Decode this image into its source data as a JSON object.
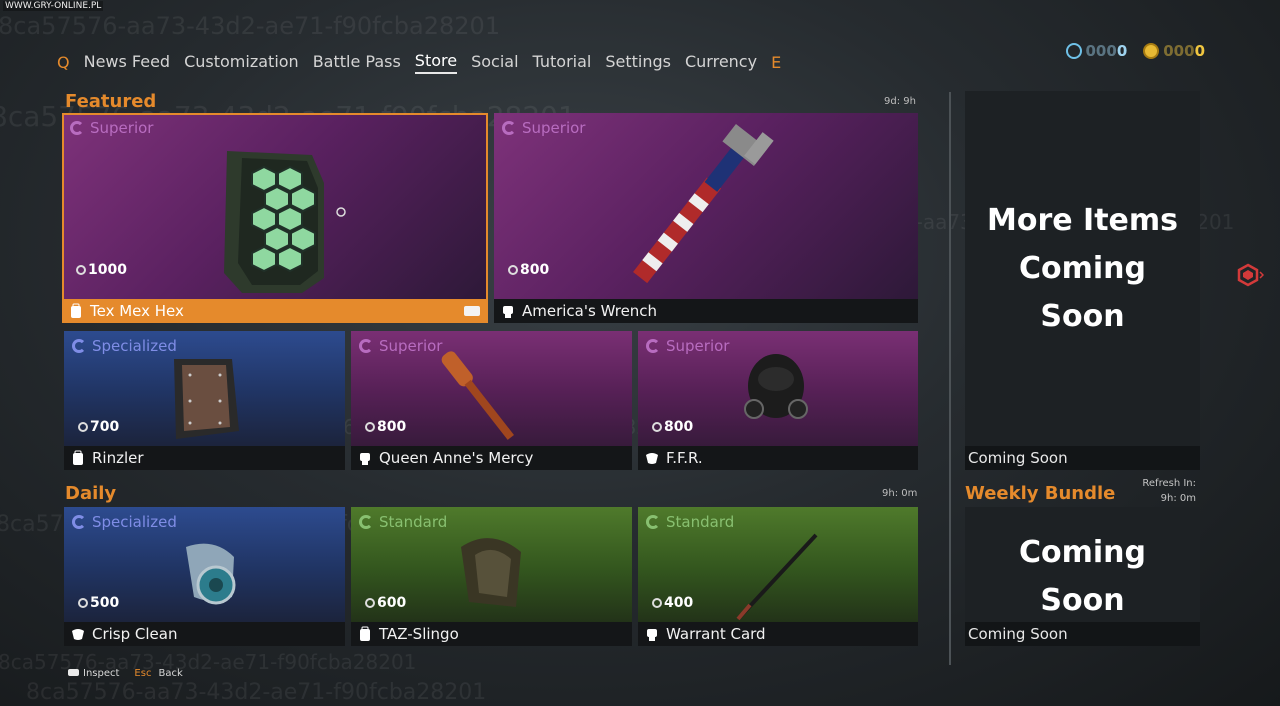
{
  "watermark": "8ca57576-aa73-43d2-ae71-f90fcba28201",
  "site_tag": "WWW.GRY-ONLINE.PL",
  "nav": {
    "left_key": "Q",
    "right_key": "E",
    "tabs": [
      "News Feed",
      "Customization",
      "Battle Pass",
      "Store",
      "Social",
      "Tutorial",
      "Settings",
      "Currency"
    ],
    "active_tab": "Store"
  },
  "currency": {
    "credits": {
      "prefix": "000",
      "value": "0",
      "icon": "credits-icon"
    },
    "premium": {
      "prefix": "000",
      "value": "0",
      "icon": "premium-coin-icon"
    }
  },
  "featured": {
    "title": "Featured",
    "timer": "9d: 9h",
    "items": [
      {
        "rarity": "Superior",
        "price": "1000",
        "name": "Tex Mex Hex",
        "type_icon": "backpack-icon",
        "selected": true
      },
      {
        "rarity": "Superior",
        "price": "800",
        "name": "America's Wrench",
        "type_icon": "fist-icon"
      },
      {
        "rarity": "Specialized",
        "price": "700",
        "name": "Rinzler",
        "type_icon": "backpack-icon"
      },
      {
        "rarity": "Superior",
        "price": "800",
        "name": "Queen Anne's Mercy",
        "type_icon": "fist-icon"
      },
      {
        "rarity": "Superior",
        "price": "800",
        "name": "F.F.R.",
        "type_icon": "mask-icon"
      }
    ]
  },
  "daily": {
    "title": "Daily",
    "timer": "9h: 0m",
    "items": [
      {
        "rarity": "Specialized",
        "price": "500",
        "name": "Crisp Clean",
        "type_icon": "mask-icon"
      },
      {
        "rarity": "Standard",
        "price": "600",
        "name": "TAZ-Slingo",
        "type_icon": "backpack-icon"
      },
      {
        "rarity": "Standard",
        "price": "400",
        "name": "Warrant Card",
        "type_icon": "fist-icon"
      }
    ]
  },
  "side": {
    "more_items_lines": [
      "More Items",
      "Coming",
      "Soon"
    ],
    "more_items_footer": "Coming Soon",
    "weekly_title": "Weekly Bundle",
    "refresh_label": "Refresh In:",
    "refresh_value": "9h: 0m",
    "weekly_lines": [
      "Coming",
      "Soon"
    ],
    "weekly_footer": "Coming Soon"
  },
  "hints": {
    "inspect": "Inspect",
    "esc_key": "Esc",
    "back": "Back"
  },
  "colors": {
    "accent": "#e58a2c",
    "superior": "#b86cc0",
    "specialized": "#7f8de6",
    "standard": "#88c070"
  }
}
